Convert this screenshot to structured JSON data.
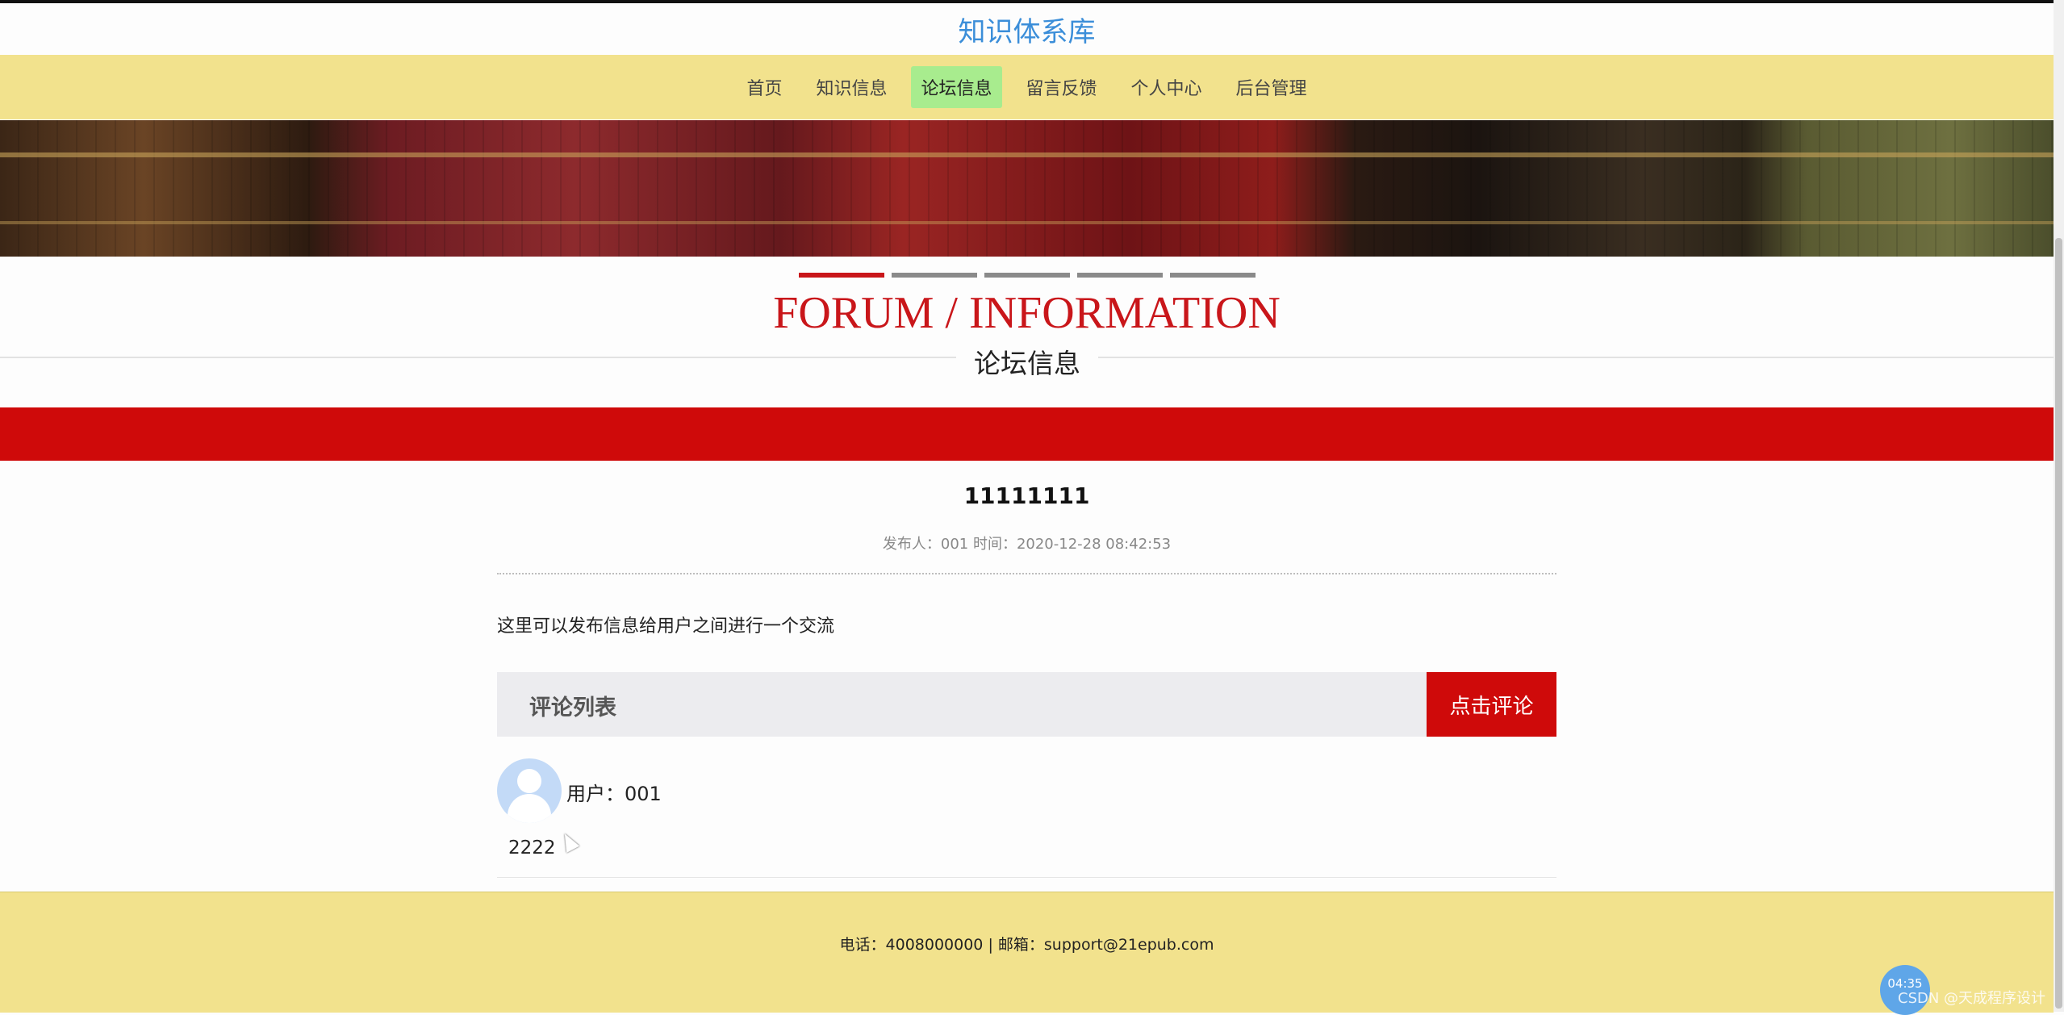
{
  "site": {
    "title": "知识体系库"
  },
  "nav": {
    "items": [
      {
        "label": "首页"
      },
      {
        "label": "知识信息"
      },
      {
        "label": "论坛信息"
      },
      {
        "label": "留言反馈"
      },
      {
        "label": "个人中心"
      },
      {
        "label": "后台管理"
      }
    ],
    "active_index": 2,
    "active_color": "#a8ec8e"
  },
  "carousel": {
    "slide_count": 5,
    "active_index": 0
  },
  "section": {
    "title_en": "FORUM / INFORMATION",
    "title_cn": "论坛信息"
  },
  "post": {
    "title": "11111111",
    "meta": "发布人：001 时间：2020-12-28 08:42:53",
    "body": "这里可以发布信息给用户之间进行一个交流"
  },
  "comments": {
    "header": "评论列表",
    "comment_button": "点击评论",
    "items": [
      {
        "user": "用户：001",
        "text": "2222"
      }
    ]
  },
  "footer": {
    "text": "电话：4008000000 | 邮箱：support@21epub.com"
  },
  "overlay": {
    "clock": "04:35",
    "watermark": "CSDN @天成程序设计"
  },
  "colors": {
    "brand_red": "#cf0a0a",
    "nav_bg": "#f2e28d",
    "title_blue": "#3b8ed9"
  }
}
